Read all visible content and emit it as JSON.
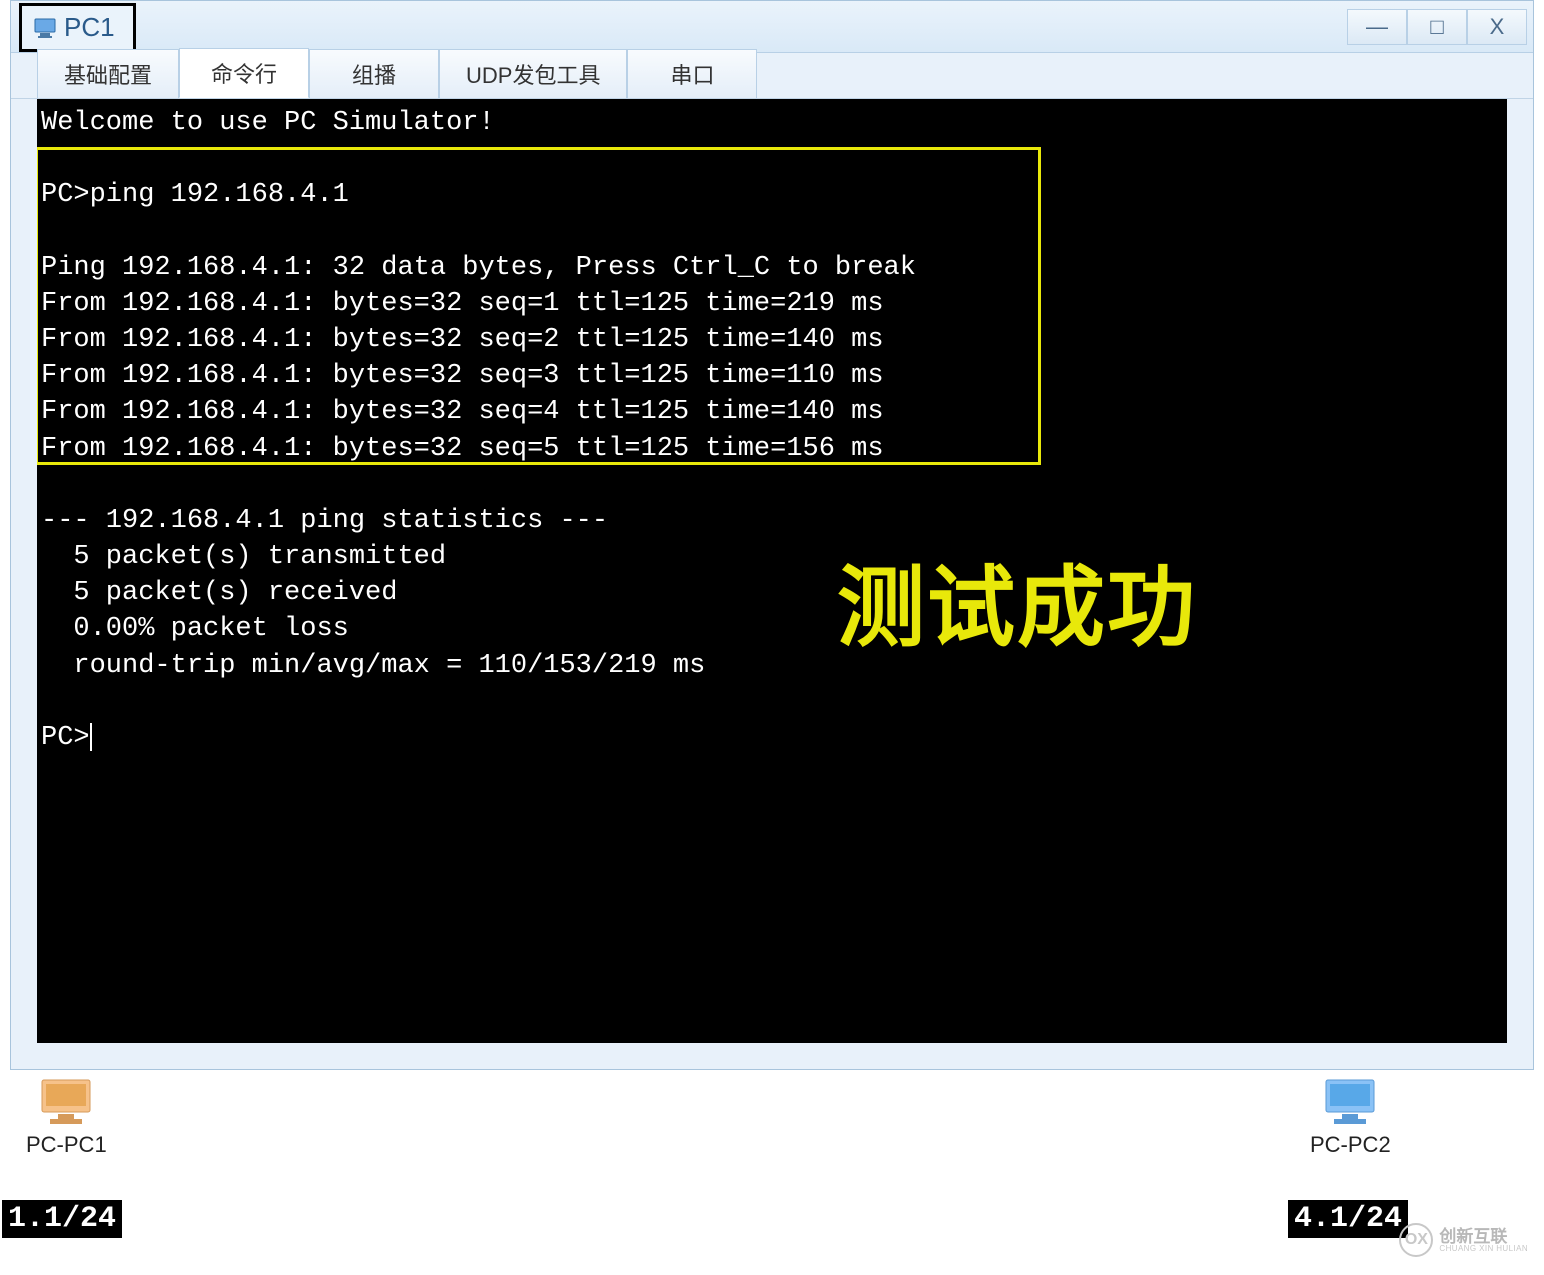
{
  "window": {
    "title": "PC1",
    "controls": {
      "minimize": "—",
      "maximize": "□",
      "close": "X"
    }
  },
  "tabs": [
    {
      "label": "基础配置",
      "active": false
    },
    {
      "label": "命令行",
      "active": true
    },
    {
      "label": "组播",
      "active": false
    },
    {
      "label": "UDP发包工具",
      "active": false
    },
    {
      "label": "串口",
      "active": false
    }
  ],
  "terminal": {
    "welcome": "Welcome to use PC Simulator!",
    "cmd": "PC>ping 192.168.4.1",
    "ping_header": "Ping 192.168.4.1: 32 data bytes, Press Ctrl_C to break",
    "replies": [
      "From 192.168.4.1: bytes=32 seq=1 ttl=125 time=219 ms",
      "From 192.168.4.1: bytes=32 seq=2 ttl=125 time=140 ms",
      "From 192.168.4.1: bytes=32 seq=3 ttl=125 time=110 ms",
      "From 192.168.4.1: bytes=32 seq=4 ttl=125 time=140 ms",
      "From 192.168.4.1: bytes=32 seq=5 ttl=125 time=156 ms"
    ],
    "stats_header": "--- 192.168.4.1 ping statistics ---",
    "stats": [
      "  5 packet(s) transmitted",
      "  5 packet(s) received",
      "  0.00% packet loss",
      "  round-trip min/avg/max = 110/153/219 ms"
    ],
    "prompt": "PC>",
    "success_overlay": "测试成功"
  },
  "devices": {
    "pc1": {
      "label": "PC-PC1",
      "ip": "1.1/24"
    },
    "pc2": {
      "label": "PC-PC2",
      "ip": "4.1/24"
    }
  },
  "watermark": {
    "cn": "创新互联",
    "en": "CHUANG XIN HULIAN",
    "badge": "OX"
  }
}
